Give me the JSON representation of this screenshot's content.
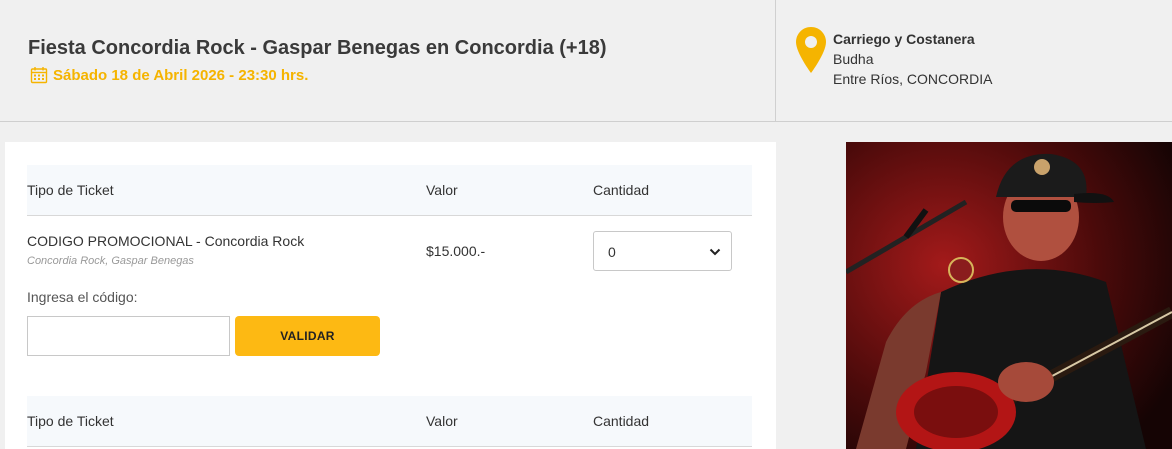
{
  "event": {
    "title": "Fiesta Concordia Rock - Gaspar Benegas en Concordia (+18)",
    "date": "Sábado 18 de Abril 2026 - 23:30 hrs.",
    "accent_color": "#f5b400"
  },
  "venue": {
    "street": "Carriego y Costanera",
    "name": "Budha",
    "location": "Entre Ríos, CONCORDIA",
    "icon": "map-pin-icon"
  },
  "table": {
    "headers": [
      "Tipo de Ticket",
      "Valor",
      "Cantidad"
    ]
  },
  "ticket": {
    "name": "CODIGO PROMOCIONAL - Concordia Rock",
    "tags": "Concordia Rock, Gaspar Benegas",
    "price": "$15.000.-",
    "quantity": "0"
  },
  "promo": {
    "label": "Ingresa el código:",
    "input_value": "",
    "button_label": "VALIDAR",
    "button_color": "#fdb913"
  }
}
